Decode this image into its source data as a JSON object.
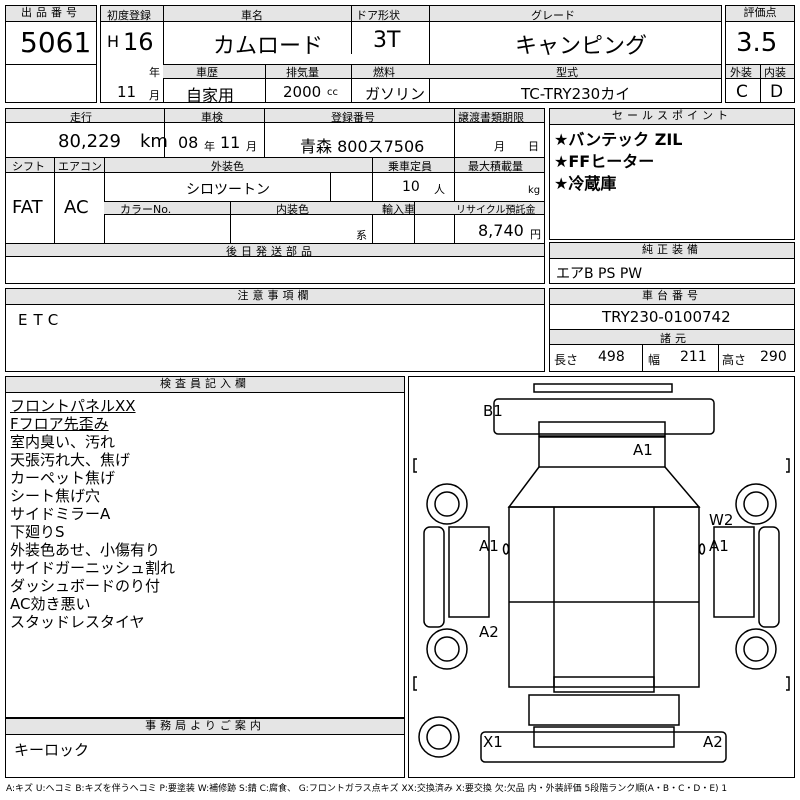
{
  "top": {
    "lot_label": "出品番号",
    "lot": "5061",
    "first_reg_label": "初度登録",
    "era": "H",
    "year": "16",
    "year_unit": "年",
    "month": "11",
    "month_unit": "月",
    "name_label": "車名",
    "name": "カムロード",
    "door_label": "ドア形状",
    "door": "3T",
    "grade_label": "グレード",
    "grade": "キャンピング",
    "score_label": "評価点",
    "score": "3.5",
    "history_label": "車歴",
    "history": "自家用",
    "displacement_label": "排気量",
    "displacement": "2000",
    "displacement_unit": "cc",
    "fuel_label": "燃料",
    "fuel": "ガソリン",
    "model_label": "型式",
    "model": "TC-TRY230カイ",
    "ext_label": "外装",
    "ext": "C",
    "int_label": "内装",
    "int": "D"
  },
  "row2": {
    "mileage_label": "走行",
    "mileage": "80,229",
    "mileage_unit": "km",
    "inspection_label": "車検",
    "insp_year": "08",
    "insp_year_unit": "年",
    "insp_month": "11",
    "insp_month_unit": "月",
    "reg_label": "登録番号",
    "reg": "青森 800ス7506",
    "transfer_label": "譲渡書類期限",
    "transfer_month": "月",
    "transfer_day": "日",
    "shift_label": "シフト",
    "shift": "FAT",
    "ac_label": "エアコン",
    "ac": "AC",
    "color_label": "外装色",
    "color": "シロツートン",
    "capacity_label": "乗車定員",
    "capacity": "10",
    "capacity_unit": "人",
    "load_label": "最大積載量",
    "load_unit": "kg",
    "color_no_label": "カラーNo.",
    "interior_color_label": "内装色",
    "interior_color_unit": "系",
    "import_label": "輸入車",
    "recycle_label": "リサイクル預託金",
    "recycle": "8,740",
    "recycle_unit": "円",
    "later_parts_label": "後日発送部品"
  },
  "sales": {
    "label": "セールスポイント",
    "items": [
      "★バンテック ZIL",
      "★FFヒーター",
      "★冷蔵庫"
    ]
  },
  "equipment": {
    "label": "純正装備",
    "value": "エアB PS PW"
  },
  "notes": {
    "label": "注意事項欄",
    "value": "ETC"
  },
  "chassis": {
    "label": "車台番号",
    "value": "TRY230-0100742"
  },
  "dims": {
    "label": "諸元",
    "length_label": "長さ",
    "length": "498",
    "width_label": "幅",
    "width": "211",
    "height_label": "高さ",
    "height": "290"
  },
  "inspector": {
    "label": "検査員記入欄",
    "items": [
      "フロントパネルXX",
      "Fフロア先歪み",
      "室内臭い、汚れ",
      "天張汚れ大、焦げ",
      "カーペット焦げ",
      "シート焦げ穴",
      "サイドミラーA",
      "下廻りS",
      "外装色あせ、小傷有り",
      "サイドガーニッシュ割れ",
      "ダッシュボードのり付",
      "AC効き悪い",
      "スタッドレスタイヤ"
    ]
  },
  "office": {
    "label": "事務局よりご案内",
    "value": "キーロック"
  },
  "diagram": {
    "marks": [
      "B1",
      "A1",
      "W2",
      "A1",
      "A1",
      "A2",
      "X1",
      "A2"
    ]
  },
  "footer": "A:キズ U:ヘコミ B:キズを伴うヘコミ P:要塗装 W:補修跡 S:錆 C:腐食、 G:フロントガラス点キズ XX:交換済み X:要交換 欠:欠品 内・外装評価 5段階ランク順(A・B・C・D・E) 1"
}
